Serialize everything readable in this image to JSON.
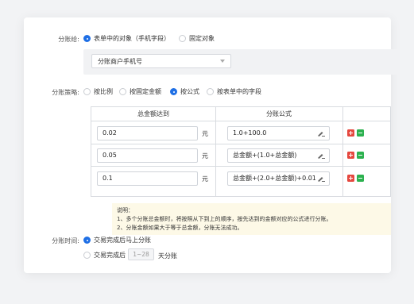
{
  "split_to": {
    "label": "分账给:",
    "options": [
      {
        "label": "表单中的对象（手机字段）",
        "selected": true
      },
      {
        "label": "固定对象",
        "selected": false
      }
    ],
    "select_value": "分账商户手机号"
  },
  "strategy": {
    "label": "分账策略:",
    "options": [
      {
        "label": "按比例",
        "selected": false
      },
      {
        "label": "按固定金额",
        "selected": false
      },
      {
        "label": "按公式",
        "selected": true
      },
      {
        "label": "按表单中的字段",
        "selected": false
      }
    ],
    "table": {
      "headers": [
        "总金额达到",
        "分账公式"
      ],
      "unit": "元",
      "rows": [
        {
          "amount": "0.02",
          "formula": "1.0+100.0"
        },
        {
          "amount": "0.05",
          "formula": "总金额+(1.0+总金额)"
        },
        {
          "amount": "0.1",
          "formula": "总金额+(2.0+总金额)+0.01"
        }
      ]
    },
    "note": {
      "title": "说明：",
      "line1": "1、多个分账总金额时，将按照从下到上的顺序，按先达到的金额对应的公式进行分账。",
      "line2": "2、分账金额如果大于等于总金额，分账无法成功。"
    }
  },
  "timing": {
    "label": "分账时间:",
    "options": [
      {
        "label": "交易完成后马上分账",
        "selected": true
      },
      {
        "label": "交易完成后",
        "selected": false
      }
    ],
    "days_placeholder": "1~28",
    "days_suffix": "天分账"
  },
  "colors": {
    "accent": "#1f6fe5",
    "delete": "#e5483f",
    "add": "#2cb14f",
    "note_bg": "#fdf9e7"
  }
}
